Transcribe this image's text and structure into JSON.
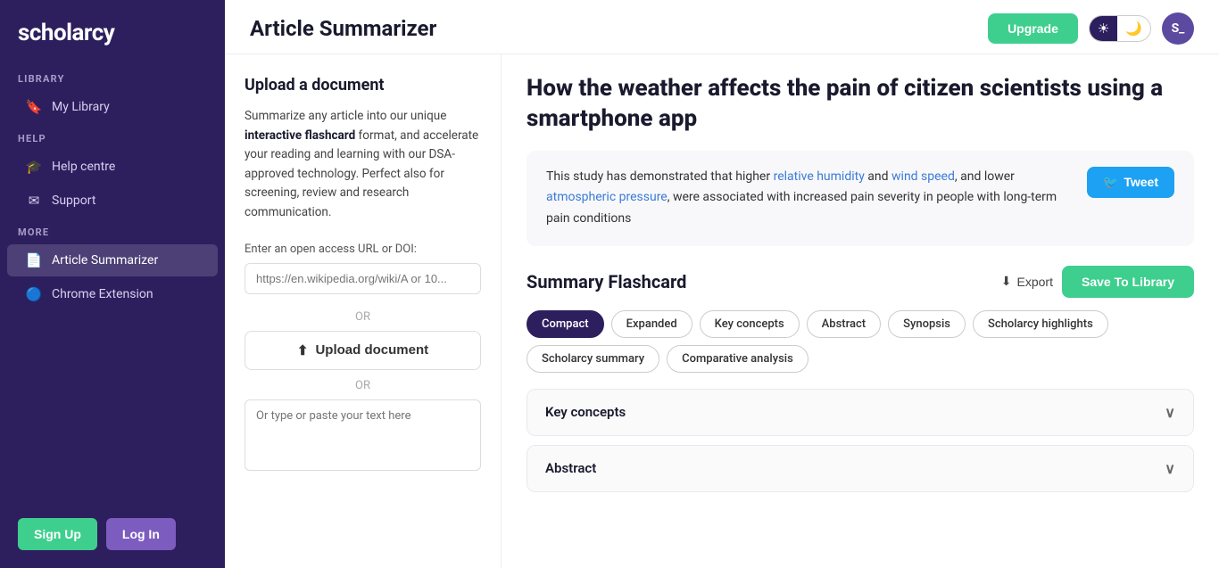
{
  "sidebar": {
    "logo": "scholarcy",
    "sections": [
      {
        "label": "Library",
        "items": [
          {
            "id": "my-library",
            "icon": "🔖",
            "label": "My Library",
            "active": false
          }
        ]
      },
      {
        "label": "Help",
        "items": [
          {
            "id": "help-centre",
            "icon": "🎓",
            "label": "Help centre",
            "active": false
          },
          {
            "id": "support",
            "icon": "✉",
            "label": "Support",
            "active": false
          }
        ]
      },
      {
        "label": "More",
        "items": [
          {
            "id": "article-summarizer",
            "icon": "📄",
            "label": "Article Summarizer",
            "active": true
          },
          {
            "id": "chrome-extension",
            "icon": "🔵",
            "label": "Chrome Extension",
            "active": false
          }
        ]
      }
    ],
    "signup_label": "Sign Up",
    "login_label": "Log In"
  },
  "topbar": {
    "title": "Article Summarizer",
    "upgrade_label": "Upgrade",
    "theme_light_icon": "☀",
    "theme_dark_icon": "🌙",
    "avatar_text": "S_"
  },
  "left_panel": {
    "section_title": "Upload a document",
    "description": "Summarize any article into our unique {interactive flashcard} format, and accelerate your reading and learning with our DSA-approved technology. Perfect also for screening, review and research communication.",
    "description_plain": "Summarize any article into our unique ",
    "description_bold": "interactive flashcard",
    "description_after": " format, and accelerate your reading and learning with our DSA-approved technology. Perfect also for screening, review and research communication.",
    "url_label": "Enter an open access URL or DOI:",
    "url_placeholder": "https://en.wikipedia.org/wiki/A or 10...",
    "or1": "OR",
    "upload_label": "Upload document",
    "upload_icon": "⬆",
    "or2": "OR",
    "text_placeholder": "Or type or paste your text here"
  },
  "right_panel": {
    "article_title": "How the weather affects the pain of citizen scientists using a smartphone app",
    "summary": {
      "text_before": "This study has demonstrated that higher ",
      "link1": "relative humidity",
      "text_middle1": " and ",
      "link2": "wind speed",
      "text_middle2": ", and lower ",
      "link3": "atmospheric pressure",
      "text_after": ", were associated with increased pain severity in people with long-term pain conditions",
      "tweet_label": "Tweet",
      "tweet_icon": "🐦"
    },
    "flashcard": {
      "title": "Summary Flashcard",
      "export_label": "Export",
      "export_icon": "⬇",
      "save_label": "Save To Library"
    },
    "tabs": [
      {
        "id": "compact",
        "label": "Compact",
        "active": true
      },
      {
        "id": "expanded",
        "label": "Expanded",
        "active": false
      },
      {
        "id": "key-concepts",
        "label": "Key concepts",
        "active": false
      },
      {
        "id": "abstract",
        "label": "Abstract",
        "active": false
      },
      {
        "id": "synopsis",
        "label": "Synopsis",
        "active": false
      },
      {
        "id": "scholarcy-highlights",
        "label": "Scholarcy highlights",
        "active": false
      },
      {
        "id": "scholarcy-summary",
        "label": "Scholarcy summary",
        "active": false
      },
      {
        "id": "comparative-analysis",
        "label": "Comparative analysis",
        "active": false
      }
    ],
    "accordions": [
      {
        "id": "key-concepts-acc",
        "label": "Key concepts"
      },
      {
        "id": "abstract-acc",
        "label": "Abstract"
      }
    ]
  }
}
